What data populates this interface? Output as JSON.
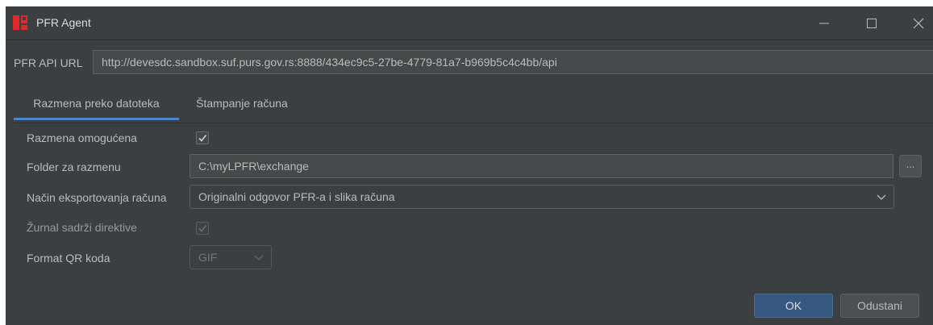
{
  "window": {
    "title": "PFR Agent",
    "icons": {
      "app": "pfr-logo-icon",
      "minimize": "minimize-icon",
      "maximize": "maximize-icon",
      "close": "close-icon"
    },
    "colors": {
      "background": "#3c3f41",
      "accent": "#4a88c7",
      "logo": "#e0282b"
    }
  },
  "api": {
    "label": "PFR API URL",
    "value": "http://devesdc.sandbox.suf.purs.gov.rs:8888/434ec9c5-27be-4779-81a7-b969b5c4c4bb/api"
  },
  "tabs": [
    {
      "label": "Razmena preko datoteka",
      "active": true
    },
    {
      "label": "Štampanje računa",
      "active": false
    }
  ],
  "form": {
    "exchange_enabled": {
      "label": "Razmena omogućena",
      "checked": true
    },
    "folder": {
      "label": "Folder za razmenu",
      "value": "C:\\myLPFR\\exchange",
      "browse_label": "..."
    },
    "export_mode": {
      "label": "Način eksportovanja računa",
      "value": "Originalni odgovor PFR-a i slika računa"
    },
    "journal": {
      "label": "Žurnal sadrži direktive",
      "checked": true,
      "disabled": true
    },
    "qr_format": {
      "label": "Format QR koda",
      "value": "GIF",
      "disabled": true
    }
  },
  "buttons": {
    "ok": "OK",
    "cancel": "Odustani"
  }
}
